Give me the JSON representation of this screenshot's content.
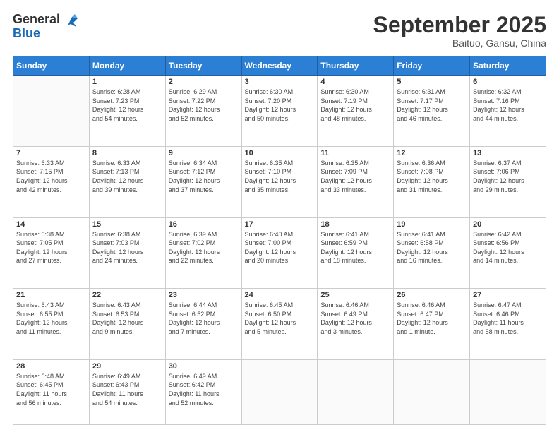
{
  "logo": {
    "general": "General",
    "blue": "Blue"
  },
  "header": {
    "month": "September 2025",
    "location": "Baituo, Gansu, China"
  },
  "days_of_week": [
    "Sunday",
    "Monday",
    "Tuesday",
    "Wednesday",
    "Thursday",
    "Friday",
    "Saturday"
  ],
  "weeks": [
    [
      {
        "day": "",
        "info": ""
      },
      {
        "day": "1",
        "info": "Sunrise: 6:28 AM\nSunset: 7:23 PM\nDaylight: 12 hours\nand 54 minutes."
      },
      {
        "day": "2",
        "info": "Sunrise: 6:29 AM\nSunset: 7:22 PM\nDaylight: 12 hours\nand 52 minutes."
      },
      {
        "day": "3",
        "info": "Sunrise: 6:30 AM\nSunset: 7:20 PM\nDaylight: 12 hours\nand 50 minutes."
      },
      {
        "day": "4",
        "info": "Sunrise: 6:30 AM\nSunset: 7:19 PM\nDaylight: 12 hours\nand 48 minutes."
      },
      {
        "day": "5",
        "info": "Sunrise: 6:31 AM\nSunset: 7:17 PM\nDaylight: 12 hours\nand 46 minutes."
      },
      {
        "day": "6",
        "info": "Sunrise: 6:32 AM\nSunset: 7:16 PM\nDaylight: 12 hours\nand 44 minutes."
      }
    ],
    [
      {
        "day": "7",
        "info": "Sunrise: 6:33 AM\nSunset: 7:15 PM\nDaylight: 12 hours\nand 42 minutes."
      },
      {
        "day": "8",
        "info": "Sunrise: 6:33 AM\nSunset: 7:13 PM\nDaylight: 12 hours\nand 39 minutes."
      },
      {
        "day": "9",
        "info": "Sunrise: 6:34 AM\nSunset: 7:12 PM\nDaylight: 12 hours\nand 37 minutes."
      },
      {
        "day": "10",
        "info": "Sunrise: 6:35 AM\nSunset: 7:10 PM\nDaylight: 12 hours\nand 35 minutes."
      },
      {
        "day": "11",
        "info": "Sunrise: 6:35 AM\nSunset: 7:09 PM\nDaylight: 12 hours\nand 33 minutes."
      },
      {
        "day": "12",
        "info": "Sunrise: 6:36 AM\nSunset: 7:08 PM\nDaylight: 12 hours\nand 31 minutes."
      },
      {
        "day": "13",
        "info": "Sunrise: 6:37 AM\nSunset: 7:06 PM\nDaylight: 12 hours\nand 29 minutes."
      }
    ],
    [
      {
        "day": "14",
        "info": "Sunrise: 6:38 AM\nSunset: 7:05 PM\nDaylight: 12 hours\nand 27 minutes."
      },
      {
        "day": "15",
        "info": "Sunrise: 6:38 AM\nSunset: 7:03 PM\nDaylight: 12 hours\nand 24 minutes."
      },
      {
        "day": "16",
        "info": "Sunrise: 6:39 AM\nSunset: 7:02 PM\nDaylight: 12 hours\nand 22 minutes."
      },
      {
        "day": "17",
        "info": "Sunrise: 6:40 AM\nSunset: 7:00 PM\nDaylight: 12 hours\nand 20 minutes."
      },
      {
        "day": "18",
        "info": "Sunrise: 6:41 AM\nSunset: 6:59 PM\nDaylight: 12 hours\nand 18 minutes."
      },
      {
        "day": "19",
        "info": "Sunrise: 6:41 AM\nSunset: 6:58 PM\nDaylight: 12 hours\nand 16 minutes."
      },
      {
        "day": "20",
        "info": "Sunrise: 6:42 AM\nSunset: 6:56 PM\nDaylight: 12 hours\nand 14 minutes."
      }
    ],
    [
      {
        "day": "21",
        "info": "Sunrise: 6:43 AM\nSunset: 6:55 PM\nDaylight: 12 hours\nand 11 minutes."
      },
      {
        "day": "22",
        "info": "Sunrise: 6:43 AM\nSunset: 6:53 PM\nDaylight: 12 hours\nand 9 minutes."
      },
      {
        "day": "23",
        "info": "Sunrise: 6:44 AM\nSunset: 6:52 PM\nDaylight: 12 hours\nand 7 minutes."
      },
      {
        "day": "24",
        "info": "Sunrise: 6:45 AM\nSunset: 6:50 PM\nDaylight: 12 hours\nand 5 minutes."
      },
      {
        "day": "25",
        "info": "Sunrise: 6:46 AM\nSunset: 6:49 PM\nDaylight: 12 hours\nand 3 minutes."
      },
      {
        "day": "26",
        "info": "Sunrise: 6:46 AM\nSunset: 6:47 PM\nDaylight: 12 hours\nand 1 minute."
      },
      {
        "day": "27",
        "info": "Sunrise: 6:47 AM\nSunset: 6:46 PM\nDaylight: 11 hours\nand 58 minutes."
      }
    ],
    [
      {
        "day": "28",
        "info": "Sunrise: 6:48 AM\nSunset: 6:45 PM\nDaylight: 11 hours\nand 56 minutes."
      },
      {
        "day": "29",
        "info": "Sunrise: 6:49 AM\nSunset: 6:43 PM\nDaylight: 11 hours\nand 54 minutes."
      },
      {
        "day": "30",
        "info": "Sunrise: 6:49 AM\nSunset: 6:42 PM\nDaylight: 11 hours\nand 52 minutes."
      },
      {
        "day": "",
        "info": ""
      },
      {
        "day": "",
        "info": ""
      },
      {
        "day": "",
        "info": ""
      },
      {
        "day": "",
        "info": ""
      }
    ]
  ]
}
